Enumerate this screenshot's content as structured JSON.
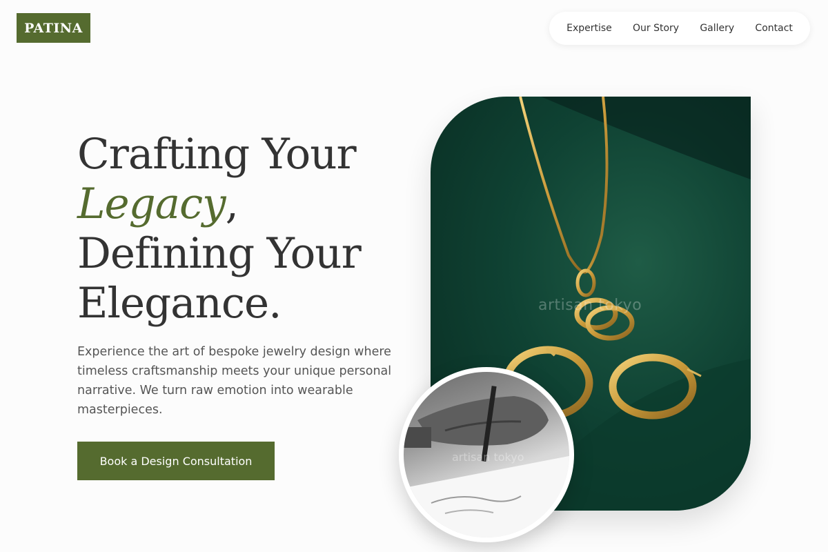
{
  "brand": {
    "name": "PATINA",
    "color": "#556b2f"
  },
  "nav": {
    "items": [
      {
        "label": "Expertise"
      },
      {
        "label": "Our Story"
      },
      {
        "label": "Gallery"
      },
      {
        "label": "Contact"
      }
    ]
  },
  "hero": {
    "line1": "Crafting Your",
    "accent": "Legacy",
    "accent_suffix": ",",
    "line3": "Defining Your",
    "line4": "Elegance.",
    "description": "Experience the art of bespoke jewelry design where timeless craftsmanship meets your unique personal narrative. We turn raw emotion into wearable masterpieces.",
    "cta_label": "Book a Design Consultation"
  },
  "images": {
    "main_watermark": "artisan tokyo",
    "sketch_watermark": "artisan tokyo"
  },
  "colors": {
    "accent": "#556b2f",
    "text": "#333333",
    "muted": "#555555",
    "background": "#fcfcfc"
  }
}
